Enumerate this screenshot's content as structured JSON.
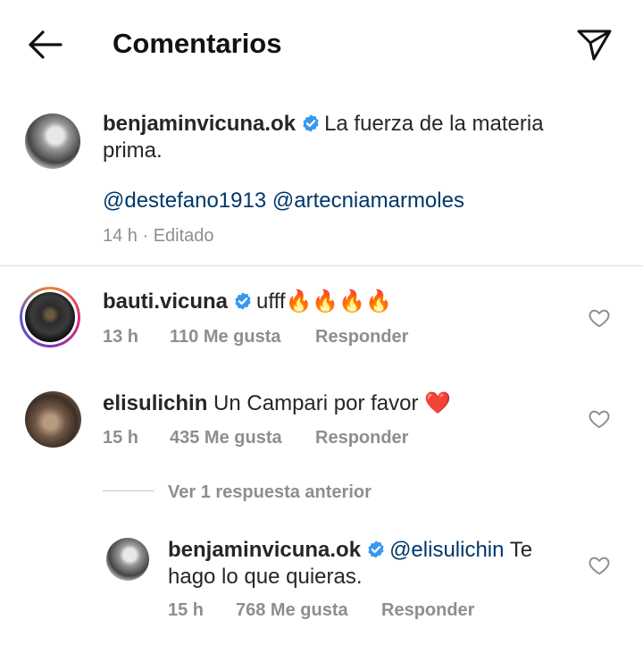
{
  "header": {
    "title": "Comentarios",
    "back_icon": "arrow-left-icon",
    "share_icon": "paper-plane-icon"
  },
  "caption": {
    "username": "benjaminvicuna.ok",
    "text_line1": "La fuerza de la materia",
    "text_line2": "prima.",
    "mentions": [
      "@destefano1913",
      "@artecniamarmoles"
    ],
    "time": "14 h",
    "edited": "· Editado"
  },
  "comments": [
    {
      "username": "bauti.vicuna",
      "text": "ufff🔥🔥🔥🔥",
      "time": "13 h",
      "likes": "110 Me gusta",
      "reply_label": "Responder"
    },
    {
      "username": "elisulichin",
      "text": "Un Campari por favor ❤️",
      "time": "15 h",
      "likes": "435 Me gusta",
      "reply_label": "Responder"
    }
  ],
  "view_replies": "Ver 1 respuesta anterior",
  "reply": {
    "username": "benjaminvicuna.ok",
    "mention": "@elisulichin",
    "text_line1": "Te",
    "text_line2": "hago lo que quieras.",
    "time": "15 h",
    "likes": "768 Me gusta",
    "reply_label": "Responder"
  },
  "colors": {
    "verified": "#3897f0",
    "mention": "#00376b",
    "meta": "#8e8e8e"
  }
}
